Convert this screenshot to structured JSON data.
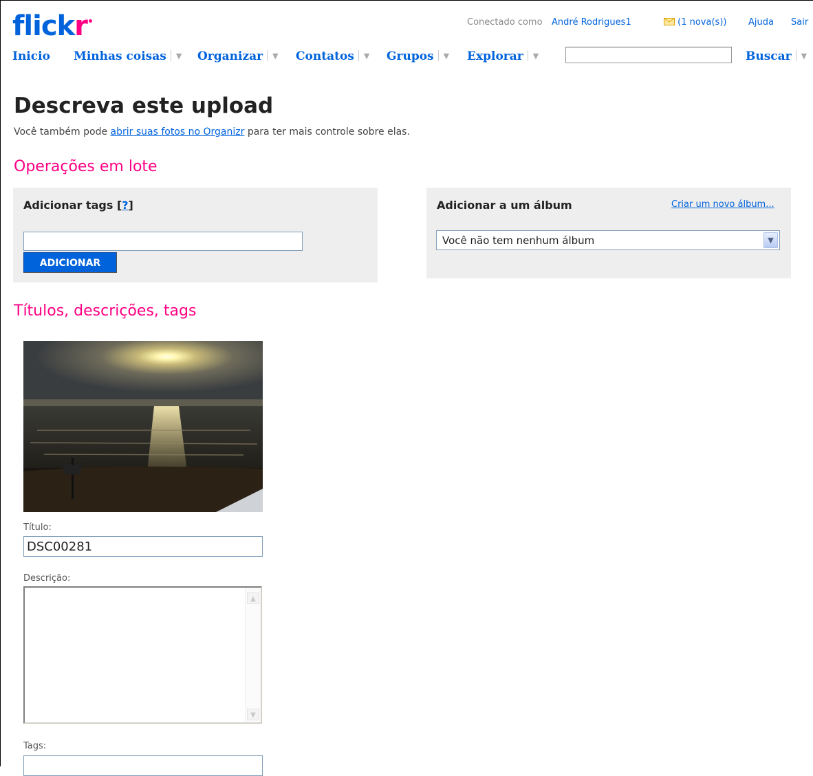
{
  "header": {
    "logo": {
      "part1": "flick",
      "part2": "r"
    },
    "connected_as_label": "Conectado como",
    "username": "André Rodrigues1",
    "messages": "(1 nova(s))",
    "help": "Ajuda",
    "logout": "Sair"
  },
  "nav": {
    "items": [
      {
        "label": "Inicio",
        "dropdown": false
      },
      {
        "label": "Minhas coisas",
        "dropdown": true
      },
      {
        "label": "Organizar",
        "dropdown": true
      },
      {
        "label": "Contatos",
        "dropdown": true
      },
      {
        "label": "Grupos",
        "dropdown": true
      },
      {
        "label": "Explorar",
        "dropdown": true
      }
    ],
    "search_value": "",
    "search_button": "Buscar"
  },
  "page": {
    "title": "Descreva este upload",
    "intro_before": "Você também pode ",
    "intro_link": "abrir suas fotos no Organizr",
    "intro_after": " para ter mais controle sobre elas."
  },
  "batch": {
    "heading": "Operações em lote",
    "tags_panel": {
      "title": "Adicionar tags",
      "help_open": "[",
      "help_link": "?",
      "help_close": "]",
      "input_value": "",
      "button": "ADICIONAR"
    },
    "album_panel": {
      "title": "Adicionar a um álbum",
      "create_link": "Criar um novo álbum...",
      "selected": "Você não tem nenhum álbum"
    }
  },
  "details": {
    "heading": "Títulos, descrições, tags",
    "title_label": "Título:",
    "title_value": "DSC00281",
    "description_label": "Descrição:",
    "description_value": "",
    "tags_label": "Tags:",
    "tags_value": ""
  },
  "colors": {
    "brand_blue": "#0063dc",
    "brand_pink": "#ff0084",
    "panel_bg": "#eeeeee"
  },
  "icons": [
    "mail-icon",
    "dropdown-arrow-icon",
    "select-chevron-icon",
    "scroll-up-icon",
    "scroll-down-icon"
  ]
}
